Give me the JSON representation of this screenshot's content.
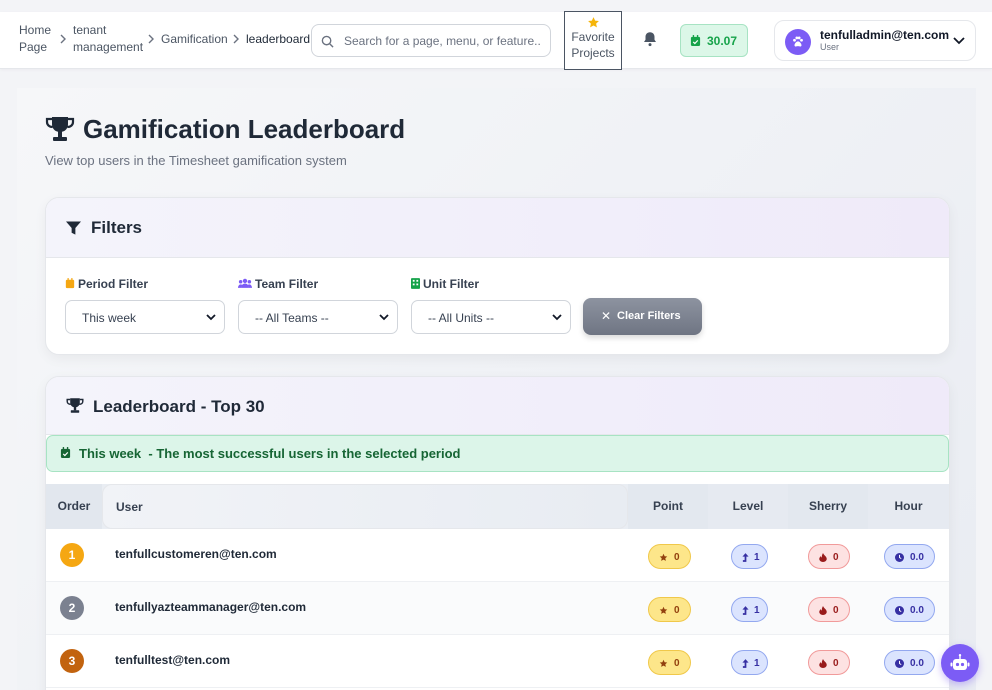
{
  "breadcrumb": {
    "home_line1": "Home",
    "home_line2": "Page",
    "tenant_line1": "tenant",
    "tenant_line2": "management",
    "gamification": "Gamification",
    "current": "leaderboard"
  },
  "search": {
    "placeholder": "Search for a page, menu, or feature.."
  },
  "favorite": {
    "line1": "Favorite",
    "line2": "Projects"
  },
  "score": {
    "value": "30.07"
  },
  "user": {
    "email": "tenfulladmin@ten.com",
    "role": "User"
  },
  "page": {
    "title": "Gamification Leaderboard",
    "subtitle": "View top users in the Timesheet gamification system"
  },
  "filters": {
    "title": "Filters",
    "period_label": "Period Filter",
    "period_value": "This week",
    "team_label": "Team Filter",
    "team_value": "-- All Teams --",
    "unit_label": "Unit Filter",
    "unit_value": "-- All Units --",
    "clear_label": "Clear Filters"
  },
  "leaderboard": {
    "title": "Leaderboard - Top 30",
    "info_period": "This week",
    "info_text": " - The most successful users in the selected period",
    "columns": {
      "order": "Order",
      "user": "User",
      "point": "Point",
      "level": "Level",
      "sherry": "Sherry",
      "hour": "Hour"
    },
    "rows": [
      {
        "rank": "1",
        "email": "tenfullcustomeren@ten.com",
        "point": "0",
        "level": "1",
        "sherry": "0",
        "hour": "0.0",
        "rank_color": "#f5a712"
      },
      {
        "rank": "2",
        "email": "tenfullyazteammanager@ten.com",
        "point": "0",
        "level": "1",
        "sherry": "0",
        "hour": "0.0",
        "rank_color": "#7b8190"
      },
      {
        "rank": "3",
        "email": "tenfulltest@ten.com",
        "point": "0",
        "level": "1",
        "sherry": "0",
        "hour": "0.0",
        "rank_color": "#c2630f"
      }
    ]
  },
  "colors": {
    "accent": "#7c5cf5",
    "success": "#16a34a",
    "title": "#1f2937"
  }
}
